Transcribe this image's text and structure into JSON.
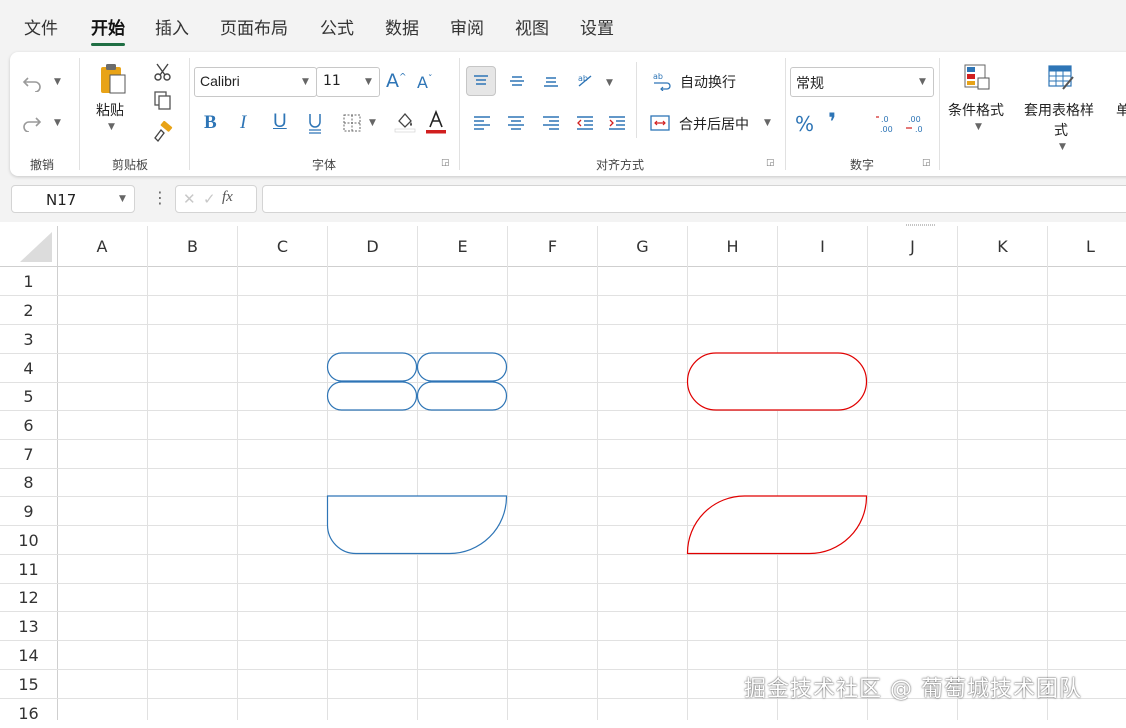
{
  "menu": {
    "tabs": [
      {
        "label": "文件"
      },
      {
        "label": "开始"
      },
      {
        "label": "插入"
      },
      {
        "label": "页面布局"
      },
      {
        "label": "公式"
      },
      {
        "label": "数据"
      },
      {
        "label": "审阅"
      },
      {
        "label": "视图"
      },
      {
        "label": "设置"
      }
    ],
    "active_tab": "开始"
  },
  "ribbon": {
    "undo_group": {
      "label": "撤销"
    },
    "clipboard": {
      "label": "剪贴板",
      "paste_label": "粘贴"
    },
    "font": {
      "label": "字体",
      "font_name": "Calibri",
      "font_size": "11",
      "bold": "B",
      "italic": "I",
      "underline": "U",
      "font_color": "#d11f1f"
    },
    "alignment": {
      "label": "对齐方式",
      "wrap_text": "自动换行",
      "merge_center": "合并后居中"
    },
    "number": {
      "label": "数字",
      "format": "常规",
      "percent": "%",
      "comma": "❜"
    },
    "styles": {
      "conditional_format": "条件格式",
      "table_style": "套用表格样式",
      "truncated": "单"
    }
  },
  "formula_bar": {
    "name_box": "N17",
    "fx": "fx",
    "value": ""
  },
  "sheet": {
    "columns": [
      "A",
      "B",
      "C",
      "D",
      "E",
      "F",
      "G",
      "H",
      "I",
      "J",
      "K",
      "L"
    ],
    "rows": [
      "1",
      "2",
      "3",
      "4",
      "5",
      "6",
      "7",
      "8",
      "9",
      "10",
      "11",
      "12",
      "13",
      "14",
      "15",
      "16"
    ],
    "shape_colors": {
      "blue": "#2e75b6",
      "red": "#e00000"
    }
  },
  "watermark": "掘金技术社区 @ 葡萄城技术团队"
}
